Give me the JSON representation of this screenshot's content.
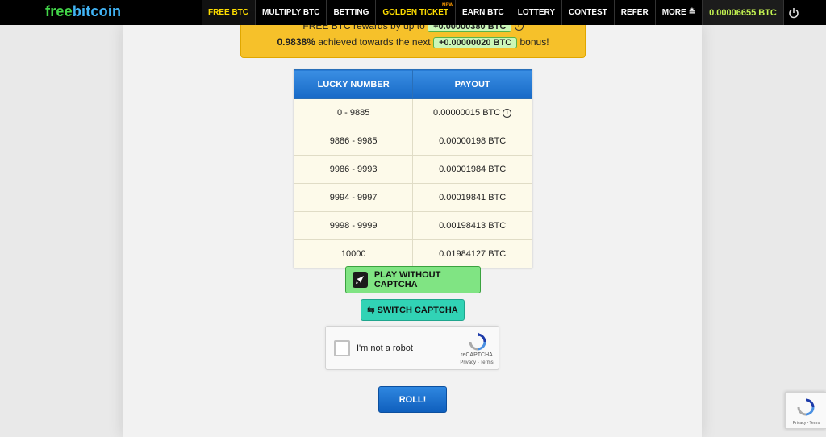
{
  "logo": {
    "free": "free",
    "bitcoin": "bitcoin"
  },
  "nav": {
    "items": [
      {
        "label": "FREE BTC"
      },
      {
        "label": "MULTIPLY BTC"
      },
      {
        "label": "BETTING"
      },
      {
        "label": "GOLDEN TICKET",
        "badge": "NEW"
      },
      {
        "label": "EARN BTC"
      },
      {
        "label": "LOTTERY"
      },
      {
        "label": "CONTEST"
      },
      {
        "label": "REFER"
      },
      {
        "label": "MORE"
      }
    ],
    "balance": "0.00006655 BTC"
  },
  "banner": {
    "line1_prefix": "FREE BTC rewards by up to",
    "line1_pill": "+0.00000380 BTC",
    "percent": "0.9838%",
    "line2_mid": "achieved towards the next",
    "line2_pill": "+0.00000020 BTC",
    "line2_suffix": "bonus!"
  },
  "payout_table": {
    "headers": [
      "LUCKY NUMBER",
      "PAYOUT"
    ],
    "rows": [
      {
        "range": "0 - 9885",
        "payout": "0.00000015 BTC"
      },
      {
        "range": "9886 - 9985",
        "payout": "0.00000198 BTC"
      },
      {
        "range": "9986 - 9993",
        "payout": "0.00001984 BTC"
      },
      {
        "range": "9994 - 9997",
        "payout": "0.00019841 BTC"
      },
      {
        "range": "9998 - 9999",
        "payout": "0.00198413 BTC"
      },
      {
        "range": "10000",
        "payout": "0.01984127 BTC"
      }
    ]
  },
  "buttons": {
    "play_without_captcha": "PLAY WITHOUT CAPTCHA",
    "switch_captcha": "SWITCH CAPTCHA",
    "roll": "ROLL!"
  },
  "recaptcha": {
    "label": "I'm not a robot",
    "brand": "reCAPTCHA",
    "terms": "Privacy - Terms"
  },
  "badge": {
    "terms": "Privacy - Terms"
  },
  "colors": {
    "nav_bg": "#000000",
    "active_nav": "#ffde00",
    "balance_text": "#c3f251",
    "banner_bg": "#f6c12a",
    "table_header": "#1769c6",
    "play_button": "#80e483",
    "switch_button": "#31d3b5",
    "roll_button": "#0f5fbd"
  }
}
